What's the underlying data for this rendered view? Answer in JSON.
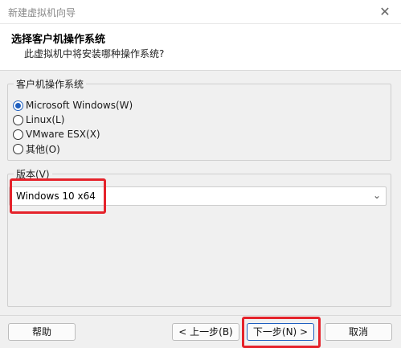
{
  "window": {
    "title": "新建虚拟机向导",
    "close_icon": "close-icon"
  },
  "header": {
    "title": "选择客户机操作系统",
    "subtitle": "此虚拟机中将安装哪种操作系统?"
  },
  "guest_os": {
    "group_label": "客户机操作系统",
    "options": [
      {
        "label": "Microsoft Windows(W)",
        "selected": true
      },
      {
        "label": "Linux(L)",
        "selected": false
      },
      {
        "label": "VMware ESX(X)",
        "selected": false
      },
      {
        "label": "其他(O)",
        "selected": false
      }
    ]
  },
  "version": {
    "group_label": "版本(V)",
    "selected": "Windows 10 x64",
    "dropdown_icon": "chevron-down-icon"
  },
  "buttons": {
    "help": "帮助",
    "back": "< 上一步(B)",
    "next": "下一步(N) >",
    "cancel": "取消"
  },
  "colors": {
    "accent": "#1f5fbf",
    "highlight": "#e5232b"
  }
}
